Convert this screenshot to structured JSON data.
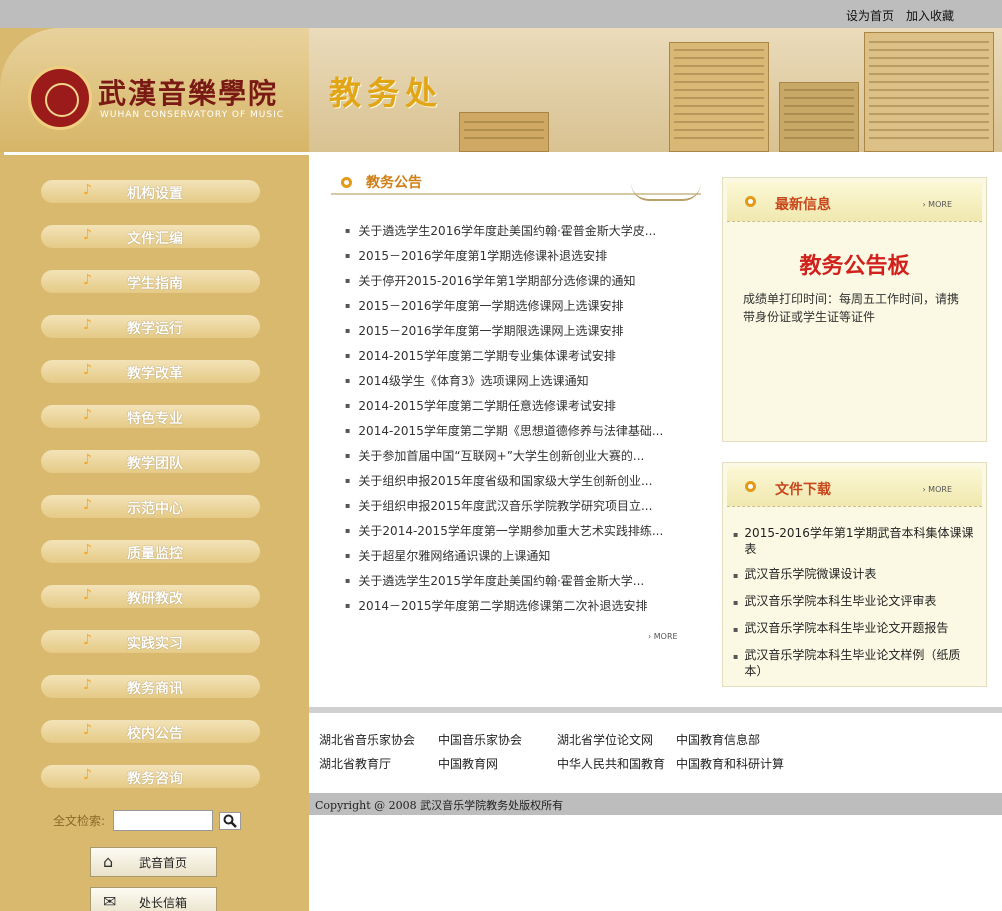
{
  "top_links": [
    "设为首页",
    "加入收藏"
  ],
  "logo": {
    "name": "武漢音樂學院",
    "english": "WUHAN CONSERVATORY OF MUSIC"
  },
  "banner": {
    "title": "教务处"
  },
  "menu": [
    "机构设置",
    "文件汇编",
    "学生指南",
    "教学运行",
    "教学改革",
    "特色专业",
    "教学团队",
    "示范中心",
    "质量监控",
    "教研教改",
    "实践实习",
    "教务商讯",
    "校内公告",
    "教务咨询"
  ],
  "search": {
    "label": "全文检索:",
    "value": ""
  },
  "quick_buttons": [
    "武音首页",
    "处长信箱"
  ],
  "notices": {
    "title": "教务公告",
    "items": [
      "关于遴选学生2016学年度赴美国约翰·霍普金斯大学皮...",
      "2015－2016学年度第1学期选修课补退选安排",
      "关于停开2015-2016学年第1学期部分选修课的通知",
      "2015－2016学年度第一学期选修课网上选课安排",
      "2015－2016学年度第一学期限选课网上选课安排",
      "2014-2015学年度第二学期专业集体课考试安排",
      "2014级学生《体育3》选项课网上选课通知",
      "2014-2015学年度第二学期任意选修课考试安排",
      "2014-2015学年度第二学期《思想道德修养与法律基础...",
      "关于参加首届中国“互联网+”大学生创新创业大赛的...",
      "关于组织申报2015年度省级和国家级大学生创新创业...",
      "关于组织申报2015年度武汉音乐学院教学研究项目立...",
      "关于2014-2015学年度第一学期参加重大艺术实践排练...",
      "关于超星尔雅网络通识课的上课通知",
      "关于遴选学生2015学年度赴美国约翰·霍普金斯大学...",
      "2014－2015学年度第二学期选修课第二次补退选安排"
    ],
    "more": "› MORE"
  },
  "latest": {
    "title": "最新信息",
    "more": "› MORE",
    "board_title": "教务公告板",
    "board_text": "成绩单打印时间：每周五工作时间，请携带身份证或学生证等证件"
  },
  "downloads": {
    "title": "文件下载",
    "more": "› MORE",
    "items": [
      "2015-2016学年第1学期武音本科集体课课表",
      "武汉音乐学院微课设计表",
      "武汉音乐学院本科生毕业论文评审表",
      "武汉音乐学院本科生毕业论文开题报告",
      "武汉音乐学院本科生毕业论文样例（纸质本）"
    ]
  },
  "links": [
    "湖北省音乐家协会",
    "中国音乐家协会",
    "湖北省学位论文网",
    "中国教育信息部",
    "湖北省教育厅",
    "中国教育网",
    "中华人民共和国教育",
    "中国教育和科研计算"
  ],
  "copyright": "Copyright @ 2008 武汉音乐学院教务处版权所有"
}
